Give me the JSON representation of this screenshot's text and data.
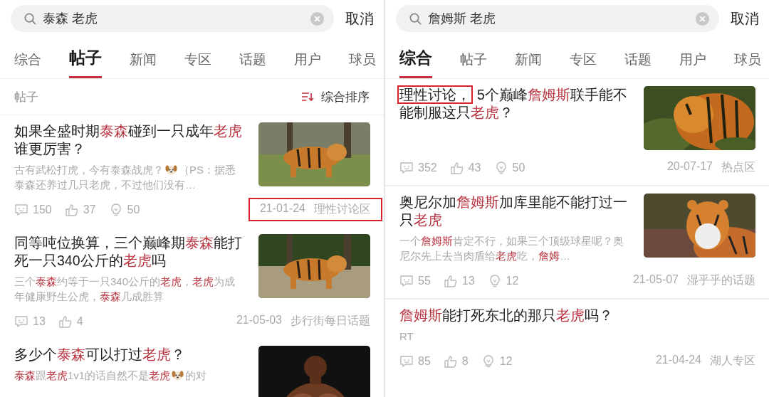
{
  "panels": [
    {
      "search": {
        "value": "泰森 老虎"
      },
      "cancel": "取消",
      "dividers": false,
      "tabs": [
        {
          "label": "综合",
          "selected": false
        },
        {
          "label": "帖子",
          "selected": true
        },
        {
          "label": "新闻",
          "selected": false
        },
        {
          "label": "专区",
          "selected": false
        },
        {
          "label": "话题",
          "selected": false
        },
        {
          "label": "用户",
          "selected": false
        },
        {
          "label": "球员",
          "selected": false
        }
      ],
      "subheader": {
        "label": "帖子",
        "sort": "综合排序"
      },
      "posts": [
        {
          "title": [
            {
              "kind": "text",
              "text": "如果全盛时期",
              "highlight": false,
              "outlined": false
            },
            {
              "kind": "text",
              "text": "泰森",
              "highlight": true,
              "outlined": false
            },
            {
              "kind": "text",
              "text": "碰到一只成年",
              "highlight": false,
              "outlined": false
            },
            {
              "kind": "text",
              "text": "老虎",
              "highlight": true,
              "outlined": false
            },
            {
              "kind": "text",
              "text": "谁更厉害？",
              "highlight": false,
              "outlined": false
            }
          ],
          "excerpt": [
            {
              "kind": "text",
              "text": "古有武松打虎，今有泰森战虎？",
              "highlight": false
            },
            {
              "kind": "emoji"
            },
            {
              "kind": "text",
              "text": "（PS：据悉泰森还养过几只老虎，不过他们没有…",
              "highlight": false
            }
          ],
          "thumbnail": {
            "kind": "picture"
          },
          "stats": [
            {
              "kind": "comment",
              "count": "150"
            },
            {
              "kind": "like",
              "count": "37"
            },
            {
              "kind": "bulb",
              "count": "50"
            }
          ],
          "meta": {
            "date": "21-01-24",
            "forum": "理性讨论区",
            "outlined": true
          }
        },
        {
          "title": [
            {
              "kind": "text",
              "text": "同等吨位换算，三个巅峰期",
              "highlight": false,
              "outlined": false
            },
            {
              "kind": "text",
              "text": "泰森",
              "highlight": true,
              "outlined": false
            },
            {
              "kind": "text",
              "text": "能打死一只340公斤的",
              "highlight": false,
              "outlined": false
            },
            {
              "kind": "text",
              "text": "老虎",
              "highlight": true,
              "outlined": false
            },
            {
              "kind": "text",
              "text": "吗",
              "highlight": false,
              "outlined": false
            }
          ],
          "excerpt": [
            {
              "kind": "text",
              "text": "三个",
              "highlight": false
            },
            {
              "kind": "text",
              "text": "泰森",
              "highlight": true
            },
            {
              "kind": "text",
              "text": "约等于一只340公斤的",
              "highlight": false
            },
            {
              "kind": "text",
              "text": "老虎",
              "highlight": true
            },
            {
              "kind": "text",
              "text": "，",
              "highlight": false
            },
            {
              "kind": "text",
              "text": "老虎",
              "highlight": true
            },
            {
              "kind": "text",
              "text": "为成年健康野生公虎，",
              "highlight": false
            },
            {
              "kind": "text",
              "text": "泰森",
              "highlight": true
            },
            {
              "kind": "text",
              "text": "几成胜算",
              "highlight": false
            }
          ],
          "thumbnail": {
            "kind": "picture"
          },
          "stats": [
            {
              "kind": "comment",
              "count": "13"
            },
            {
              "kind": "like",
              "count": "4"
            }
          ],
          "meta": {
            "date": "21-05-03",
            "forum": "步行街每日话题",
            "outlined": false
          }
        },
        {
          "title": [
            {
              "kind": "text",
              "text": "多少个",
              "highlight": false,
              "outlined": false
            },
            {
              "kind": "text",
              "text": "泰森",
              "highlight": true,
              "outlined": false
            },
            {
              "kind": "text",
              "text": "可以打过",
              "highlight": false,
              "outlined": false
            },
            {
              "kind": "text",
              "text": "老虎",
              "highlight": true,
              "outlined": false
            },
            {
              "kind": "text",
              "text": "？",
              "highlight": false,
              "outlined": false
            }
          ],
          "excerpt": [
            {
              "kind": "text",
              "text": "泰森",
              "highlight": true
            },
            {
              "kind": "text",
              "text": "跟",
              "highlight": false
            },
            {
              "kind": "text",
              "text": "老虎",
              "highlight": true
            },
            {
              "kind": "text",
              "text": "1v1的话自然不是",
              "highlight": false
            },
            {
              "kind": "text",
              "text": "老虎",
              "highlight": true
            },
            {
              "kind": "emoji"
            },
            {
              "kind": "text",
              "text": "的对",
              "highlight": false
            }
          ],
          "thumbnail": {
            "kind": "picture"
          }
        }
      ]
    },
    {
      "search": {
        "value": "詹姆斯 老虎"
      },
      "cancel": "取消",
      "dividers": true,
      "tabs": [
        {
          "label": "综合",
          "selected": true
        },
        {
          "label": "帖子",
          "selected": false
        },
        {
          "label": "新闻",
          "selected": false
        },
        {
          "label": "专区",
          "selected": false
        },
        {
          "label": "话题",
          "selected": false
        },
        {
          "label": "用户",
          "selected": false
        },
        {
          "label": "球员",
          "selected": false
        }
      ],
      "posts": [
        {
          "title": [
            {
              "kind": "text",
              "text": "理性讨论，",
              "highlight": false,
              "outlined": true
            },
            {
              "kind": "text",
              "text": "5个巅峰",
              "highlight": false,
              "outlined": false
            },
            {
              "kind": "text",
              "text": "詹姆斯",
              "highlight": true,
              "outlined": false
            },
            {
              "kind": "text",
              "text": "联手能不能制服这只",
              "highlight": false,
              "outlined": false
            },
            {
              "kind": "text",
              "text": "老虎",
              "highlight": true,
              "outlined": false
            },
            {
              "kind": "text",
              "text": "？",
              "highlight": false,
              "outlined": false
            }
          ],
          "thumbnail": {
            "kind": "picture"
          },
          "stats": [
            {
              "kind": "comment",
              "count": "352"
            },
            {
              "kind": "like",
              "count": "43"
            },
            {
              "kind": "bulb",
              "count": "50"
            }
          ],
          "meta": {
            "date": "20-07-17",
            "forum": "热点区",
            "outlined": false
          }
        },
        {
          "title": [
            {
              "kind": "text",
              "text": "奥尼尔加",
              "highlight": false,
              "outlined": false
            },
            {
              "kind": "text",
              "text": "詹姆斯",
              "highlight": true,
              "outlined": false
            },
            {
              "kind": "text",
              "text": "加库里能不能打过一只",
              "highlight": false,
              "outlined": false
            },
            {
              "kind": "text",
              "text": "老虎",
              "highlight": true,
              "outlined": false
            }
          ],
          "excerpt": [
            {
              "kind": "text",
              "text": "一个",
              "highlight": false
            },
            {
              "kind": "text",
              "text": "詹姆斯",
              "highlight": true
            },
            {
              "kind": "text",
              "text": "肯定不行，如果三个顶级球星呢？奥尼尔先上去当肉盾给",
              "highlight": false
            },
            {
              "kind": "text",
              "text": "老虎",
              "highlight": true
            },
            {
              "kind": "text",
              "text": "吃，",
              "highlight": false
            },
            {
              "kind": "text",
              "text": "詹姆",
              "highlight": true
            },
            {
              "kind": "text",
              "text": "…",
              "highlight": false
            }
          ],
          "thumbnail": {
            "kind": "picture"
          },
          "stats": [
            {
              "kind": "comment",
              "count": "55"
            },
            {
              "kind": "like",
              "count": "13"
            },
            {
              "kind": "bulb",
              "count": "12"
            }
          ],
          "meta": {
            "date": "21-05-07",
            "forum": "湿乎乎的话题",
            "outlined": false
          }
        },
        {
          "title": [
            {
              "kind": "text",
              "text": "詹姆斯",
              "highlight": true,
              "outlined": false
            },
            {
              "kind": "text",
              "text": "能打死东北的那只",
              "highlight": false,
              "outlined": false
            },
            {
              "kind": "text",
              "text": "老虎",
              "highlight": true,
              "outlined": false
            },
            {
              "kind": "text",
              "text": "吗？",
              "highlight": false,
              "outlined": false
            }
          ],
          "excerpt": [
            {
              "kind": "text",
              "text": "RT",
              "highlight": false
            }
          ],
          "stats": [
            {
              "kind": "comment",
              "count": "85"
            },
            {
              "kind": "like",
              "count": "8"
            },
            {
              "kind": "bulb",
              "count": "12"
            }
          ],
          "meta": {
            "date": "21-04-24",
            "forum": "湖人专区",
            "outlined": false
          }
        }
      ]
    }
  ]
}
